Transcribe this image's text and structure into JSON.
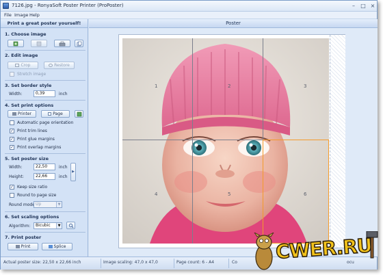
{
  "window": {
    "title": "7126.jpg - RonyaSoft Poster Printer (ProPoster)",
    "controls": {
      "minimize": "–",
      "maximize": "□",
      "close": "×"
    }
  },
  "menu": [
    "File",
    "Image",
    "Help"
  ],
  "left_panel": {
    "header": "Print a great poster yourself!",
    "choose_image": {
      "title": "1. Choose image"
    },
    "edit_image": {
      "title": "2. Edit image",
      "crop_label": "Crop",
      "restore_label": "Restore",
      "stretch_label": "Stretch image",
      "stretch_checked": false
    },
    "border_style": {
      "title": "3. Set border style",
      "width_label": "Width:",
      "width_value": "0,39",
      "width_unit": "inch"
    },
    "print_options": {
      "title": "4. Set print options",
      "printer_label": "Printer",
      "page_label": "Page",
      "options": [
        {
          "label": "Automatic page orientation",
          "checked": false
        },
        {
          "label": "Print trim lines",
          "checked": true
        },
        {
          "label": "Print glue margins",
          "checked": true
        },
        {
          "label": "Print overlap margins",
          "checked": true
        }
      ]
    },
    "poster_size": {
      "title": "5. Set poster size",
      "width_label": "Width:",
      "width_value": "22,50",
      "width_unit": "inch",
      "height_label": "Height:",
      "height_value": "22,66",
      "height_unit": "inch",
      "keep_ratio_label": "Keep size ratio",
      "keep_ratio_checked": true,
      "round_label": "Round to page size",
      "round_checked": false,
      "round_mode_label": "Round mode:",
      "round_mode_value": "Up"
    },
    "scaling": {
      "title": "6. Set scaling options",
      "algorithm_label": "Algorithm:",
      "algorithm_value": "Bicubic"
    },
    "print_poster": {
      "title": "7. Print poster",
      "print_label": "Print",
      "splice_label": "Splice"
    }
  },
  "poster": {
    "header": "Poster",
    "page_numbers": [
      "1",
      "2",
      "3",
      "4",
      "5",
      "6"
    ]
  },
  "status": {
    "actual_size": "Actual poster size: 22,50 x 22,66 inch",
    "image_scaling": "Image scaling: 47,0 x 47,0",
    "page_count": "Page count: 6 - A4",
    "extra_1": "Co",
    "extra_2": "ocu"
  },
  "watermark": {
    "text": "CWER.RU"
  },
  "colors": {
    "panel_bg": "#d3e2f6",
    "accent_blue": "#1e3256",
    "selected_page_outline": "#f39a2b",
    "hat_pink": "#e8779b",
    "eye_teal": "#3f8f9a"
  }
}
